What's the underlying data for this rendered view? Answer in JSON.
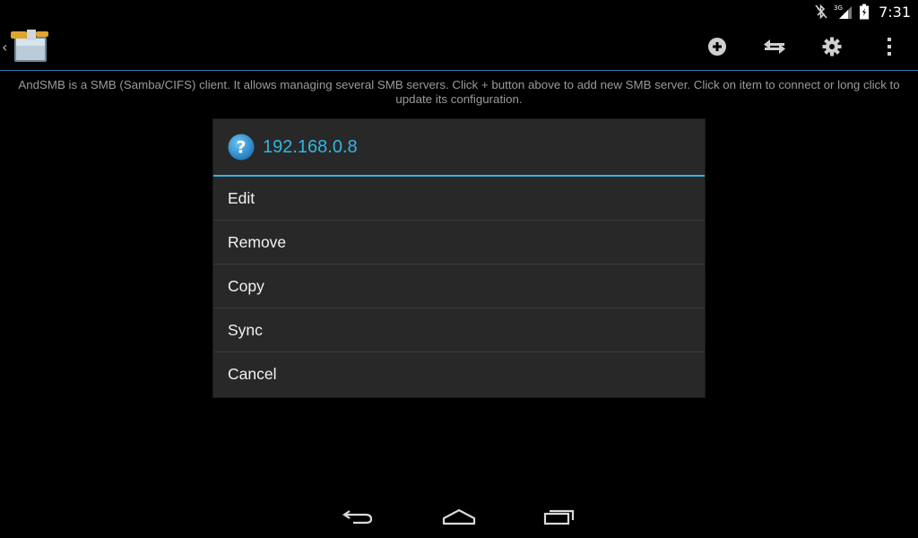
{
  "status_bar": {
    "time": "7:31",
    "network_label": "3G",
    "icons": [
      "bluetooth-off-icon",
      "signal-icon",
      "battery-icon"
    ]
  },
  "action_bar": {
    "app_icon": "andsmb-app-icon",
    "actions": [
      {
        "name": "add-server-icon",
        "label": "Add"
      },
      {
        "name": "transfer-icon",
        "label": "Transfers"
      },
      {
        "name": "settings-icon",
        "label": "Settings"
      },
      {
        "name": "overflow-menu-icon",
        "label": "More"
      }
    ],
    "divider_color": "#2f7ca8"
  },
  "description": "AndSMB is a SMB (Samba/CIFS) client. It allows managing several SMB servers. Click + button above to add new SMB server. Click on item to connect or long click to update its configuration.",
  "dialog": {
    "title": "192.168.0.8",
    "icon": "question-icon",
    "accent_color": "#33b5e5",
    "items": [
      {
        "label": "Edit"
      },
      {
        "label": "Remove"
      },
      {
        "label": "Copy"
      },
      {
        "label": "Sync"
      },
      {
        "label": "Cancel"
      }
    ]
  },
  "nav_bar": {
    "buttons": [
      "back-icon",
      "home-icon",
      "recent-apps-icon"
    ]
  }
}
